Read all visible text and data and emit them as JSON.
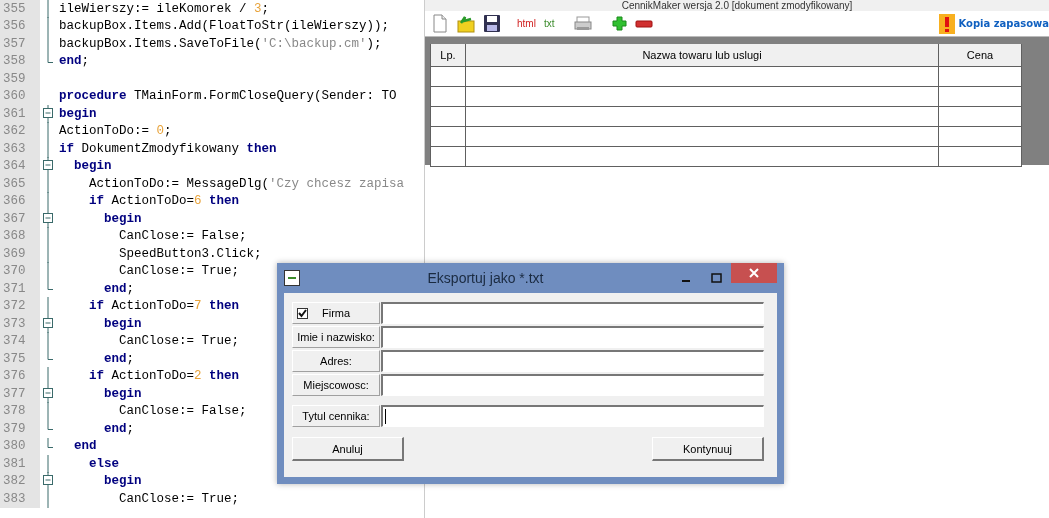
{
  "editor": {
    "lines": [
      {
        "number": "355",
        "kind": "fold_line",
        "tokens": [
          {
            "kind": "plain",
            "text": "ileWierszy:= ileKomorek / "
          },
          {
            "kind": "num",
            "text": "3"
          },
          {
            "kind": "plain",
            "text": ";"
          }
        ]
      },
      {
        "number": "356",
        "kind": "fold_line",
        "tokens": [
          {
            "kind": "plain",
            "text": "backupBox.Items.Add(FloatToStr(ileWierszy));"
          }
        ]
      },
      {
        "number": "357",
        "kind": "fold_line",
        "tokens": [
          {
            "kind": "plain",
            "text": "backupBox.Items.SaveToFile("
          },
          {
            "kind": "str",
            "text": "'C:\\backup.cm'"
          },
          {
            "kind": "plain",
            "text": ");"
          }
        ]
      },
      {
        "number": "358",
        "kind": "fold_end",
        "tokens": [
          {
            "kind": "kw",
            "text": "end"
          },
          {
            "kind": "plain",
            "text": ";"
          }
        ]
      },
      {
        "number": "359",
        "kind": "plain"
      },
      {
        "number": "360",
        "kind": "plain",
        "tokens": [
          {
            "kind": "kw",
            "text": "procedure"
          },
          {
            "kind": "plain",
            "text": " TMainForm.FormCloseQuery(Sender: TO"
          }
        ]
      },
      {
        "number": "361",
        "kind": "fold_start",
        "tokens": [
          {
            "kind": "kw",
            "text": "begin"
          }
        ]
      },
      {
        "number": "362",
        "kind": "fold_line",
        "tokens": [
          {
            "kind": "plain",
            "text": "ActionToDo:= "
          },
          {
            "kind": "num",
            "text": "0"
          },
          {
            "kind": "plain",
            "text": ";"
          }
        ]
      },
      {
        "number": "363",
        "kind": "fold_line",
        "tokens": [
          {
            "kind": "kw",
            "text": "if"
          },
          {
            "kind": "plain",
            "text": " DokumentZmodyfikowany "
          },
          {
            "kind": "kw",
            "text": "then"
          }
        ]
      },
      {
        "number": "364",
        "kind": "fold_start",
        "tokens": [
          {
            "kind": "kw",
            "text": "  begin"
          }
        ]
      },
      {
        "number": "365",
        "kind": "fold_line",
        "tokens": [
          {
            "kind": "plain",
            "text": "    ActionToDo:= MessageDlg("
          },
          {
            "kind": "str",
            "text": "'Czy chcesz zapisa"
          }
        ]
      },
      {
        "number": "366",
        "kind": "fold_line",
        "tokens": [
          {
            "kind": "kw",
            "text": "    if"
          },
          {
            "kind": "plain",
            "text": " ActionToDo="
          },
          {
            "kind": "num",
            "text": "6"
          },
          {
            "kind": "kw",
            "text": " then"
          }
        ]
      },
      {
        "number": "367",
        "kind": "fold_start",
        "tokens": [
          {
            "kind": "kw",
            "text": "      begin"
          }
        ]
      },
      {
        "number": "368",
        "kind": "fold_line",
        "tokens": [
          {
            "kind": "plain",
            "text": "        CanClose:= False;"
          }
        ]
      },
      {
        "number": "369",
        "kind": "fold_line",
        "tokens": [
          {
            "kind": "plain",
            "text": "        SpeedButton3.Click;"
          }
        ]
      },
      {
        "number": "370",
        "kind": "fold_line",
        "tokens": [
          {
            "kind": "plain",
            "text": "        CanClose:= True;"
          }
        ]
      },
      {
        "number": "371",
        "kind": "fold_end",
        "tokens": [
          {
            "kind": "kw",
            "text": "      end"
          },
          {
            "kind": "plain",
            "text": ";"
          }
        ]
      },
      {
        "number": "372",
        "kind": "fold_line",
        "tokens": [
          {
            "kind": "kw",
            "text": "    if"
          },
          {
            "kind": "plain",
            "text": " ActionToDo="
          },
          {
            "kind": "num",
            "text": "7"
          },
          {
            "kind": "kw",
            "text": " then"
          }
        ]
      },
      {
        "number": "373",
        "kind": "fold_start",
        "tokens": [
          {
            "kind": "kw",
            "text": "      begin"
          }
        ]
      },
      {
        "number": "374",
        "kind": "fold_line",
        "tokens": [
          {
            "kind": "plain",
            "text": "        CanClose:= True;"
          }
        ]
      },
      {
        "number": "375",
        "kind": "fold_end",
        "tokens": [
          {
            "kind": "kw",
            "text": "      end"
          },
          {
            "kind": "plain",
            "text": ";"
          }
        ]
      },
      {
        "number": "376",
        "kind": "fold_line",
        "tokens": [
          {
            "kind": "kw",
            "text": "    if"
          },
          {
            "kind": "plain",
            "text": " ActionToDo="
          },
          {
            "kind": "num",
            "text": "2"
          },
          {
            "kind": "kw",
            "text": " then"
          }
        ]
      },
      {
        "number": "377",
        "kind": "fold_start",
        "tokens": [
          {
            "kind": "kw",
            "text": "      begin"
          }
        ]
      },
      {
        "number": "378",
        "kind": "fold_line",
        "tokens": [
          {
            "kind": "plain",
            "text": "        CanClose:= False;"
          }
        ]
      },
      {
        "number": "379",
        "kind": "fold_end",
        "tokens": [
          {
            "kind": "kw",
            "text": "      end"
          },
          {
            "kind": "plain",
            "text": ";"
          }
        ]
      },
      {
        "number": "380",
        "kind": "fold_end",
        "tokens": [
          {
            "kind": "kw",
            "text": "  end"
          }
        ]
      },
      {
        "number": "381",
        "kind": "fold_line",
        "tokens": [
          {
            "kind": "kw",
            "text": "    else"
          }
        ]
      },
      {
        "number": "382",
        "kind": "fold_start",
        "tokens": [
          {
            "kind": "kw",
            "text": "      begin"
          }
        ]
      },
      {
        "number": "383",
        "kind": "fold_line",
        "tokens": [
          {
            "kind": "plain",
            "text": "        CanClose:= True;"
          }
        ]
      }
    ]
  },
  "app": {
    "title": "CennikMaker wersja 2.0 [dokument zmodyfikowany]",
    "toolbar": [
      {
        "kind": "new"
      },
      {
        "kind": "open"
      },
      {
        "kind": "save"
      },
      {
        "kind": "html",
        "text": "html"
      },
      {
        "kind": "txt",
        "text": "txt"
      },
      {
        "kind": "print"
      },
      {
        "kind": "add"
      },
      {
        "kind": "remove"
      }
    ],
    "backup": {
      "label": "Kopia zapasowa"
    },
    "table": {
      "columns": [
        "Lp.",
        "Nazwa towaru lub uslugi",
        "Cena"
      ],
      "rows": [
        {
          "kind": "blank"
        },
        {
          "kind": "blank"
        },
        {
          "kind": "blank"
        },
        {
          "kind": "blank"
        },
        {
          "kind": "blank"
        }
      ]
    }
  },
  "dialog": {
    "title": "Eksportuj jako *.txt",
    "fields": [
      {
        "label": "Firma",
        "kind": "checkbox",
        "checked": true,
        "focused": false
      },
      {
        "label": "Imie i nazwisko:",
        "kind": "plain",
        "focused": false
      },
      {
        "label": "Adres:",
        "kind": "plain",
        "focused": false
      },
      {
        "label": "Miejscowosc:",
        "kind": "plain",
        "focused": false
      },
      {
        "label": "Tytul cennika:",
        "kind": "plain",
        "focused": true
      }
    ],
    "buttons": [
      "Anuluj",
      "Kontynuuj"
    ]
  }
}
